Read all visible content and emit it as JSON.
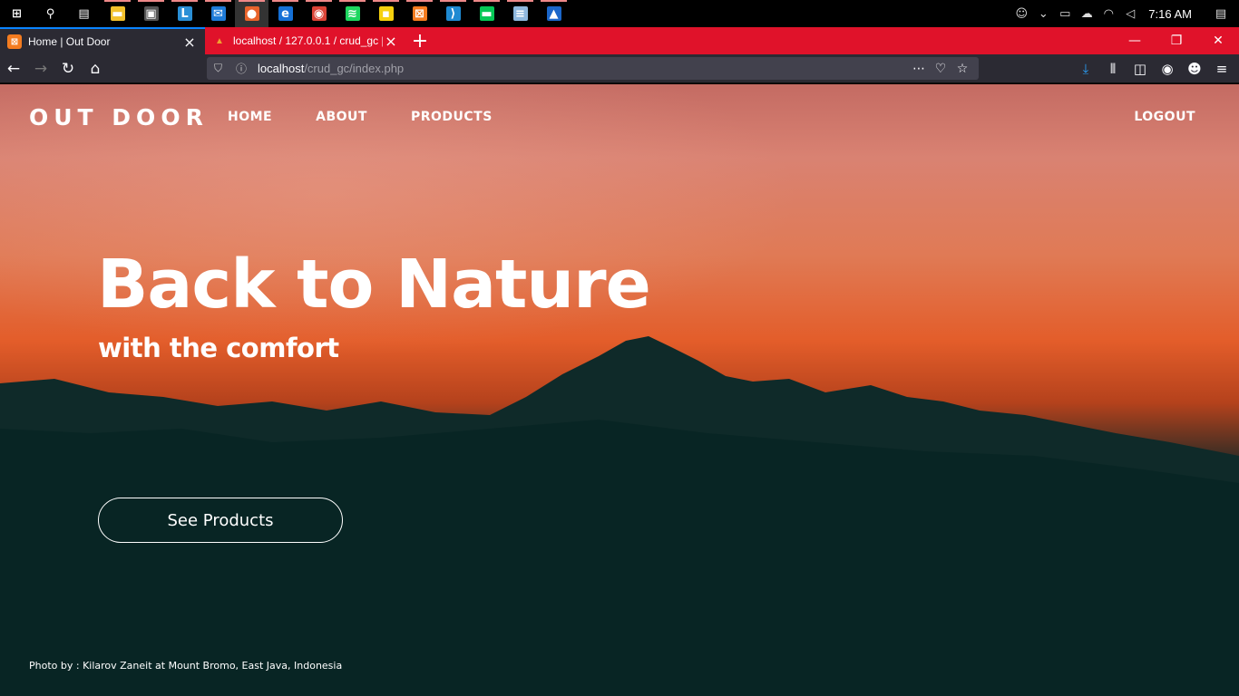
{
  "taskbar": {
    "apps": [
      {
        "name": "windows-start-icon",
        "glyph": "⊞",
        "color": "#000000"
      },
      {
        "name": "search-icon",
        "glyph": "⚲",
        "color": "#000000"
      },
      {
        "name": "task-view-icon",
        "glyph": "▤",
        "color": "#000000"
      },
      {
        "name": "file-explorer-icon",
        "glyph": "▬",
        "color": "#f3c12c"
      },
      {
        "name": "store-icon",
        "glyph": "▣",
        "color": "#555555"
      },
      {
        "name": "l-app-icon",
        "glyph": "L",
        "color": "#2a8fd6"
      },
      {
        "name": "mail-icon",
        "glyph": "✉",
        "color": "#1e7bd8"
      },
      {
        "name": "firefox-icon",
        "glyph": "●",
        "color": "#e8632b"
      },
      {
        "name": "edge-icon",
        "glyph": "e",
        "color": "#1570d6"
      },
      {
        "name": "chrome-icon",
        "glyph": "◉",
        "color": "#db4437"
      },
      {
        "name": "spotify-icon",
        "glyph": "≋",
        "color": "#1ed760"
      },
      {
        "name": "sticky-notes-icon",
        "glyph": "▪",
        "color": "#f6d10e"
      },
      {
        "name": "xampp-icon",
        "glyph": "⊠",
        "color": "#f47c20"
      },
      {
        "name": "vscode-icon",
        "glyph": "⟩",
        "color": "#1f8ad2"
      },
      {
        "name": "line-icon",
        "glyph": "▬",
        "color": "#06c755"
      },
      {
        "name": "notepad-icon",
        "glyph": "≡",
        "color": "#8fb8de"
      },
      {
        "name": "photos-icon",
        "glyph": "▲",
        "color": "#1b66c9"
      }
    ],
    "clock": "7:16 AM"
  },
  "tabs": [
    {
      "title": "Home | Out Door",
      "favicon_color": "#f47c20",
      "active": true
    },
    {
      "title": "localhost / 127.0.0.1 / crud_gc |",
      "favicon_color": "#f0a030",
      "active": false
    }
  ],
  "urlbar": {
    "host": "localhost",
    "path": "/crud_gc/index.php"
  },
  "site": {
    "brand": "OUT DOOR",
    "menu": [
      "HOME",
      "ABOUT",
      "PRODUCTS"
    ],
    "logout": "LOGOUT",
    "hero_title": "Back to Nature",
    "hero_subtitle": "with the comfort",
    "cta": "See Products",
    "credit": "Photo by : Kilarov Zaneit at Mount Bromo, East Java, Indonesia"
  }
}
